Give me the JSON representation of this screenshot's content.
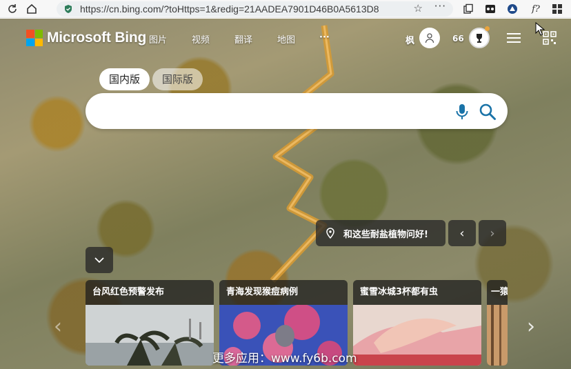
{
  "browser": {
    "url": "https://cn.bing.com/?toHttps=1&redig=21AADEA7901D46B0A5613D8",
    "more_label": "···",
    "ext_f_label": "f?"
  },
  "header": {
    "brand": "Microsoft Bing",
    "nav": [
      {
        "label": "图片"
      },
      {
        "label": "视频"
      },
      {
        "label": "翻译"
      },
      {
        "label": "地图"
      },
      {
        "label": "···"
      }
    ],
    "user_name": "枫",
    "points": "66"
  },
  "search": {
    "tabs": [
      {
        "label": "国内版",
        "active": true
      },
      {
        "label": "国际版",
        "active": false
      }
    ],
    "value": "",
    "placeholder": ""
  },
  "image_info": {
    "caption": "和这些耐盐植物问好!",
    "prev_label": "‹",
    "next_label": "›"
  },
  "news": {
    "cards": [
      {
        "title": "台风红色预警发布"
      },
      {
        "title": "青海发现猴痘病例"
      },
      {
        "title": "蜜雪冰城3杯都有虫"
      },
      {
        "title": "一猿"
      }
    ],
    "prev_label": "‹",
    "next_label": "›"
  },
  "watermark": "更多应用：www.fy6b.com",
  "colors": {
    "accent": "#1a73a8",
    "logo_red": "#f25022",
    "logo_green": "#7fba00",
    "logo_blue": "#00a4ef",
    "logo_yellow": "#ffb900"
  }
}
